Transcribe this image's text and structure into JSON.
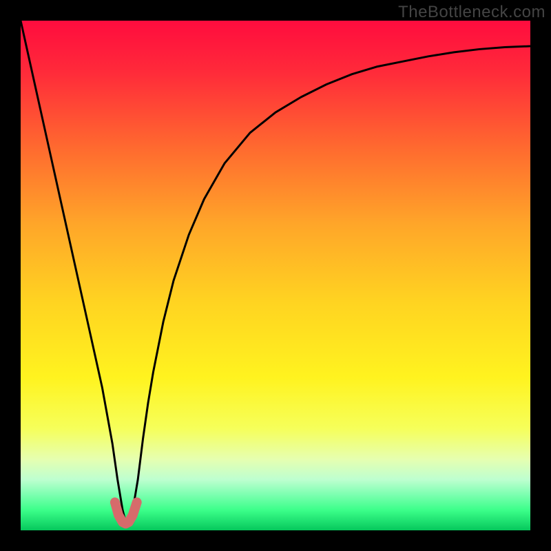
{
  "watermark": "TheBottleneck.com",
  "chart_data": {
    "type": "line",
    "title": "",
    "xlabel": "",
    "ylabel": "",
    "xlim": [
      0,
      100
    ],
    "ylim": [
      0,
      100
    ],
    "series": [
      {
        "name": "bottleneck-curve",
        "x": [
          0,
          2,
          4,
          6,
          8,
          10,
          12,
          14,
          16,
          18,
          19,
          20,
          20.5,
          21,
          22,
          23,
          24,
          25,
          26,
          28,
          30,
          33,
          36,
          40,
          45,
          50,
          55,
          60,
          65,
          70,
          75,
          80,
          85,
          90,
          95,
          100
        ],
        "values": [
          100,
          91,
          82,
          73,
          64,
          55,
          46,
          37,
          28,
          17,
          10,
          4,
          2,
          2,
          4,
          10,
          18,
          25,
          31,
          41,
          49,
          58,
          65,
          72,
          78,
          82,
          85,
          87.5,
          89.5,
          91,
          92,
          93,
          93.8,
          94.4,
          94.8,
          95
        ]
      },
      {
        "name": "optimal-range-marker",
        "x": [
          18.5,
          19.2,
          20.0,
          20.6,
          21.2,
          22.0,
          22.8
        ],
        "values": [
          5.5,
          3.0,
          1.6,
          1.3,
          1.6,
          3.0,
          5.5
        ]
      }
    ],
    "gradient_stops": [
      {
        "offset": 0,
        "color": "#ff0c3e"
      },
      {
        "offset": 0.1,
        "color": "#ff2a3a"
      },
      {
        "offset": 0.25,
        "color": "#ff6a2f"
      },
      {
        "offset": 0.4,
        "color": "#ffa629"
      },
      {
        "offset": 0.55,
        "color": "#ffd321"
      },
      {
        "offset": 0.7,
        "color": "#fff31f"
      },
      {
        "offset": 0.8,
        "color": "#f6ff5a"
      },
      {
        "offset": 0.86,
        "color": "#e6ffb0"
      },
      {
        "offset": 0.9,
        "color": "#beffd0"
      },
      {
        "offset": 0.93,
        "color": "#7cffb0"
      },
      {
        "offset": 0.96,
        "color": "#3cff8a"
      },
      {
        "offset": 1.0,
        "color": "#06c85c"
      }
    ],
    "marker_color": "#d66b6b"
  }
}
